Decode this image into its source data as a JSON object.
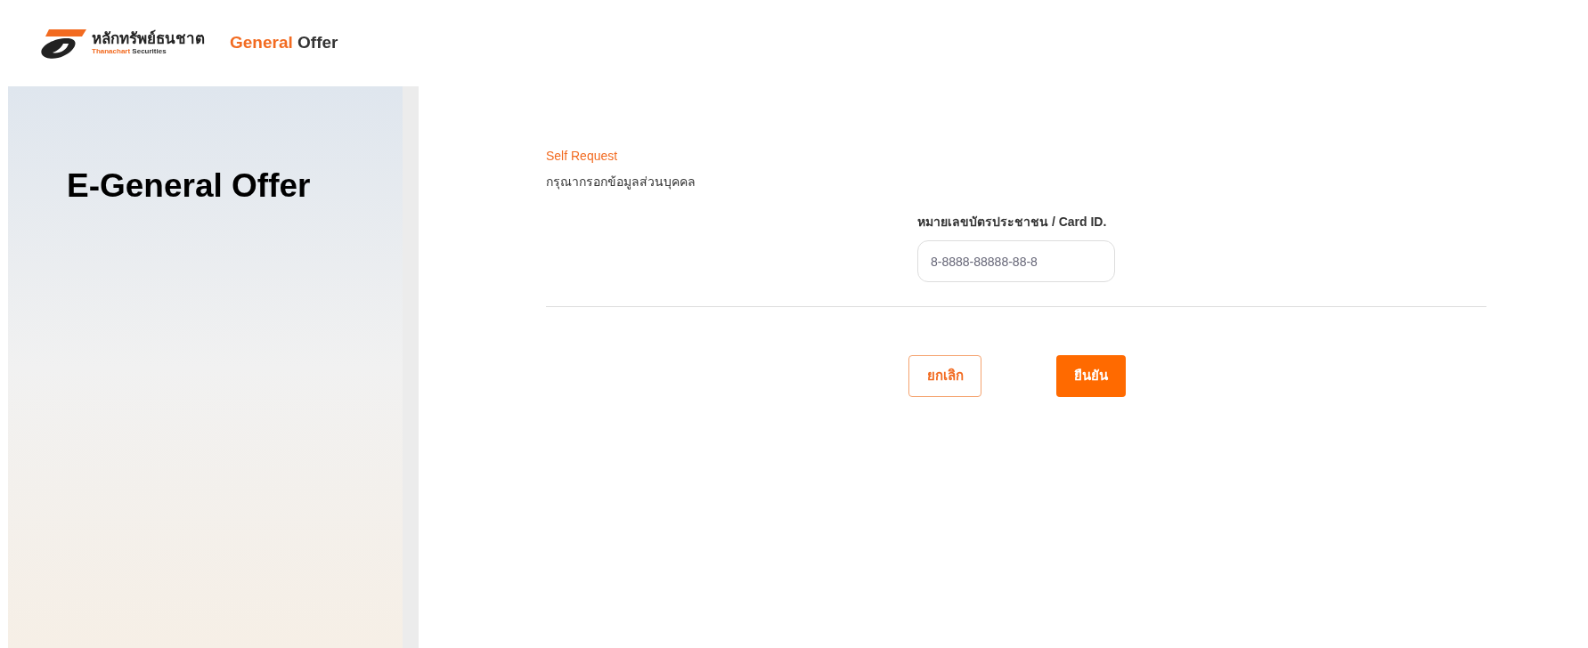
{
  "header": {
    "logo_thai": "หลักทรัพย์ธนชาต",
    "logo_en_accent": "Thanachart",
    "logo_en_rest": "Securities",
    "title_accent": "General",
    "title_rest": "Offer"
  },
  "side_panel": {
    "title": "E-General Offer"
  },
  "form": {
    "section": "Self Request",
    "instruction": "กรุณากรอกข้อมูลส่วนบุคคล",
    "field_label": "หมายเลขบัตรประชาชน / Card ID.",
    "placeholder": "8-8888-88888-88-8"
  },
  "buttons": [
    {
      "label": "ยกเลิก",
      "kind": "outline"
    },
    {
      "label": "ยืนยัน",
      "kind": "primary"
    }
  ]
}
